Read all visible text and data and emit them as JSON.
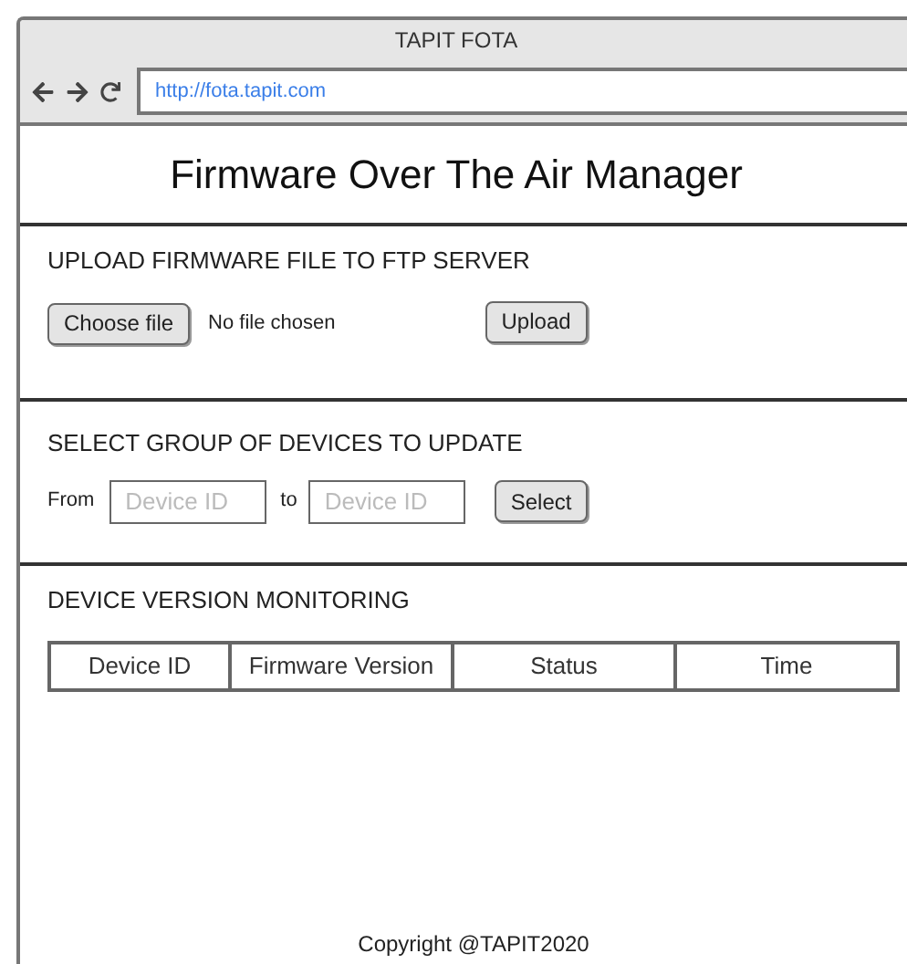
{
  "window": {
    "title": "TAPIT FOTA",
    "url": "http://fota.tapit.com"
  },
  "heading": "Firmware Over The Air Manager",
  "upload": {
    "title": "UPLOAD FIRMWARE FILE TO FTP SERVER",
    "choose_button": "Choose file",
    "file_status": "No file chosen",
    "upload_button": "Upload"
  },
  "select_group": {
    "title": "SELECT GROUP OF DEVICES TO UPDATE",
    "from_label": "From",
    "from_placeholder": "Device ID",
    "to_label": "to",
    "to_placeholder": "Device ID",
    "select_button": "Select"
  },
  "monitoring": {
    "title": "DEVICE VERSION MONITORING",
    "table": {
      "columns": [
        "Device ID",
        "Firmware Version",
        "Status",
        "Time"
      ]
    }
  },
  "footer": "Copyright @TAPIT2020"
}
